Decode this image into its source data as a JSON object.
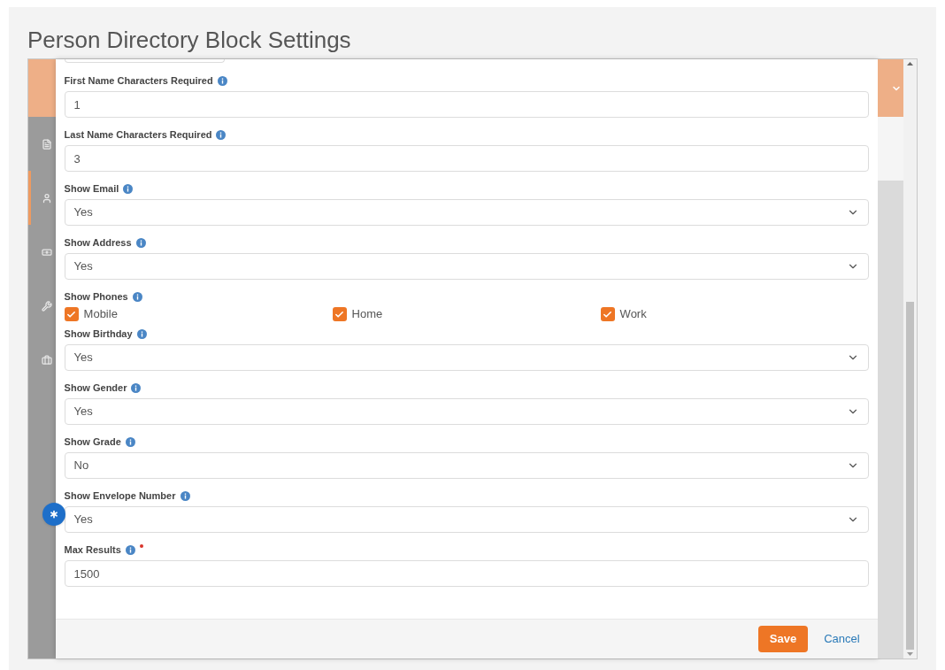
{
  "title": "Person Directory Block Settings",
  "fields": [
    {
      "kind": "text",
      "label": "First Name Characters Required",
      "value": "1",
      "required": false
    },
    {
      "kind": "text",
      "label": "Last Name Characters Required",
      "value": "3",
      "required": false
    },
    {
      "kind": "select",
      "label": "Show Email",
      "value": "Yes",
      "required": false
    },
    {
      "kind": "select",
      "label": "Show Address",
      "value": "Yes",
      "required": false
    },
    {
      "kind": "checkboxes",
      "label": "Show Phones",
      "required": false,
      "options": [
        {
          "label": "Mobile",
          "checked": true
        },
        {
          "label": "Home",
          "checked": true
        },
        {
          "label": "Work",
          "checked": true
        }
      ]
    },
    {
      "kind": "select",
      "label": "Show Birthday",
      "value": "Yes",
      "required": false
    },
    {
      "kind": "select",
      "label": "Show Gender",
      "value": "Yes",
      "required": false
    },
    {
      "kind": "select",
      "label": "Show Grade",
      "value": "No",
      "required": false
    },
    {
      "kind": "select",
      "label": "Show Envelope Number",
      "value": "Yes",
      "required": false
    },
    {
      "kind": "text",
      "label": "Max Results",
      "value": "1500",
      "required": true
    }
  ],
  "footer": {
    "save": "Save",
    "cancel": "Cancel"
  }
}
